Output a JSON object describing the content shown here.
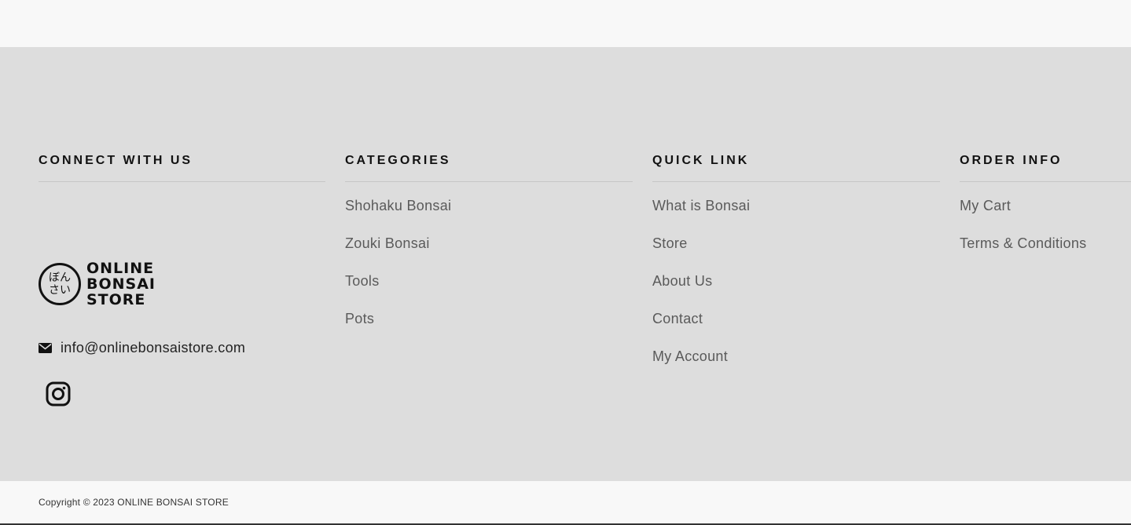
{
  "columns": {
    "connect": {
      "heading": "CONNECT WITH US",
      "logo": {
        "seal_line1": "ぼん",
        "seal_line2": "さい",
        "text_line1": "ONLINE",
        "text_line2": "BONSAI",
        "text_line3": "STORE"
      },
      "email": "info@onlinebonsaistore.com",
      "email_icon": "envelope-icon",
      "social_icon": "instagram-icon"
    },
    "categories": {
      "heading": "CATEGORIES",
      "items": [
        {
          "label": "Shohaku Bonsai"
        },
        {
          "label": "Zouki Bonsai"
        },
        {
          "label": "Tools"
        },
        {
          "label": "Pots"
        }
      ]
    },
    "quick_link": {
      "heading": "QUICK LINK",
      "items": [
        {
          "label": "What is Bonsai"
        },
        {
          "label": "Store"
        },
        {
          "label": "About Us"
        },
        {
          "label": "Contact"
        },
        {
          "label": "My Account"
        }
      ]
    },
    "order_info": {
      "heading": "ORDER INFO",
      "items": [
        {
          "label": "My Cart"
        },
        {
          "label": "Terms & Conditions"
        }
      ]
    }
  },
  "copyright": "Copyright © 2023 ONLINE BONSAI STORE",
  "colors": {
    "footer_bg": "#dddddd",
    "page_bg": "#f8f8f8",
    "heading": "#111111",
    "link": "#5a5a5a"
  }
}
